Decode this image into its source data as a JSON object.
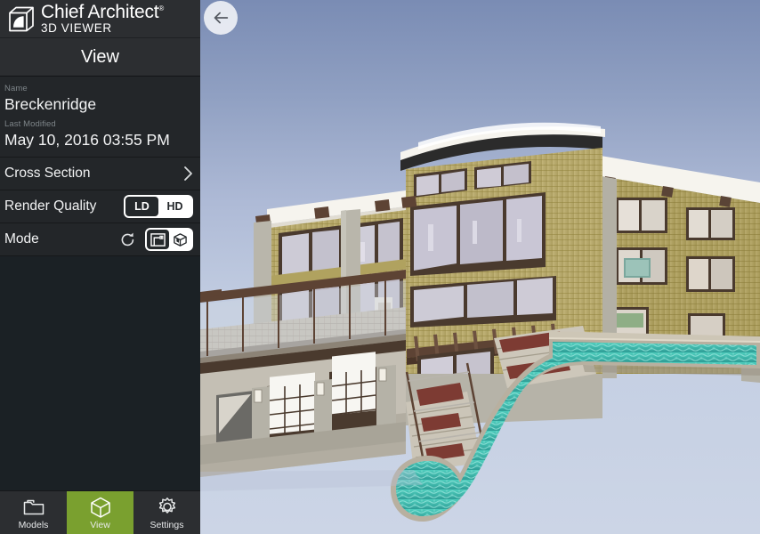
{
  "brand": {
    "name": "Chief Architect",
    "trademark": "®",
    "product": "3D VIEWER",
    "logo_icon": "cube-logo-icon"
  },
  "header": {
    "title": "View",
    "back_icon": "arrow-left-icon"
  },
  "info": {
    "name_label": "Name",
    "name_value": "Breckenridge",
    "modified_label": "Last Modified",
    "modified_value": "May 10, 2016 03:55 PM"
  },
  "rows": {
    "cross_section": {
      "label": "Cross Section",
      "chevron_icon": "chevron-right-icon"
    },
    "render_quality": {
      "label": "Render Quality",
      "options": [
        "LD",
        "HD"
      ],
      "selected": "LD"
    },
    "mode": {
      "label": "Mode",
      "refresh_icon": "refresh-icon",
      "options": [
        "floor-plan-icon",
        "cube-icon"
      ],
      "selected": "floor-plan-icon"
    }
  },
  "tabs": [
    {
      "label": "Models",
      "icon": "folder-icon",
      "active": false
    },
    {
      "label": "View",
      "icon": "cube-icon",
      "active": true
    },
    {
      "label": "Settings",
      "icon": "gear-icon",
      "active": false
    }
  ],
  "viewer": {
    "model_name": "Breckenridge",
    "description": "3D exterior rendering of a multi-level contemporary house with olive lap siding, dark brown window trim, stone columns, white fascia, glass deck railings, garage doors, exterior stairs and a curved teal swimming pool.",
    "sky_top_color": "#7a8cb4",
    "sky_bottom_color": "#ccd5e6"
  },
  "colors": {
    "accent_green": "#7aa02f",
    "sidebar_bg": "#232629",
    "header_bg": "#2c2e31",
    "panel_bg": "#1b2125",
    "text_primary": "#f2f3f4",
    "text_muted": "#7d8488",
    "siding": "#b5a668",
    "trim": "#4a3a2e",
    "stone": "#b9b6ab",
    "fascia": "#f2f0ea",
    "pool": "#3fb8ac",
    "deck": "#b9b0a2"
  }
}
